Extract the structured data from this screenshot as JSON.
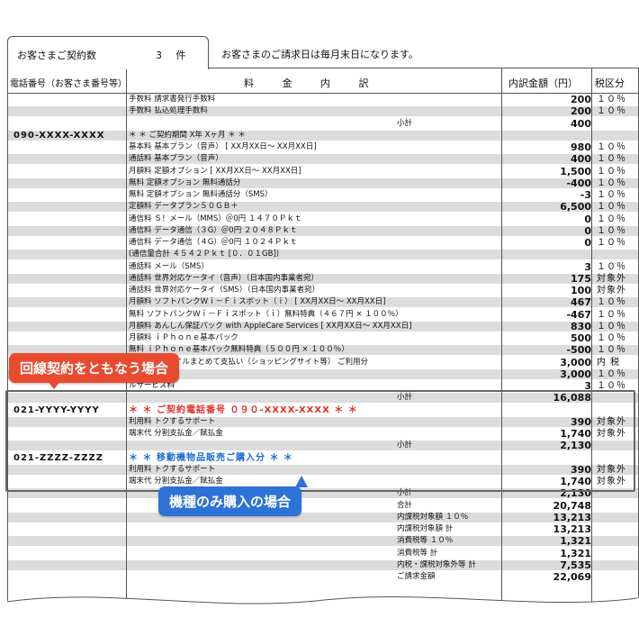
{
  "summary": {
    "contracts_label": "お客さまご契約数",
    "contracts_count": "3 件",
    "billing_notice": "お客さまのご請求日は毎月末日になります。"
  },
  "header": {
    "col_number": "電話番号（お客さま番号等）",
    "col_detail": "料 金 内 訳",
    "col_amount": "内訳金額（円）",
    "col_tax": "税区分"
  },
  "rows": [
    {
      "shade": false,
      "num": "",
      "desc": "手数料  請求書発行手数料",
      "sub": "",
      "amt": "200",
      "tax": "１０％"
    },
    {
      "shade": true,
      "num": "",
      "desc": "手数料  払込処理手数料",
      "sub": "",
      "amt": "200",
      "tax": "１０％"
    },
    {
      "shade": false,
      "num": "",
      "desc": "",
      "sub": "小計",
      "amt": "400",
      "tax": ""
    },
    {
      "shade": true,
      "num": "090-XXXX-XXXX",
      "desc": "＊ ＊ ご契約期間      X年   Xヶ月 ＊ ＊",
      "sub": "",
      "amt": "",
      "tax": ""
    },
    {
      "shade": false,
      "num": "",
      "desc": "基本料  基本プラン（音声）   [  XX月XX日～  XX月XX日]",
      "sub": "",
      "amt": "980",
      "tax": "１０％"
    },
    {
      "shade": true,
      "num": "",
      "desc": "通話料  基本プラン（音声）",
      "sub": "",
      "amt": "400",
      "tax": "１０％"
    },
    {
      "shade": false,
      "num": "",
      "desc": "月額料  定額オプション [  XX月XX日～  XX月XX日]",
      "sub": "",
      "amt": "1,500",
      "tax": "１０％"
    },
    {
      "shade": true,
      "num": "",
      "desc": "  無料   定額オプション  無料通話分",
      "sub": "",
      "amt": "-400",
      "tax": "１０％"
    },
    {
      "shade": false,
      "num": "",
      "desc": "  無料   定額オプション  無料通話分（SMS）",
      "sub": "",
      "amt": "-3",
      "tax": "１０％"
    },
    {
      "shade": true,
      "num": "",
      "desc": "定額料  データプラン５０ＧＢ＋",
      "sub": "",
      "amt": "6,500",
      "tax": "１０％"
    },
    {
      "shade": false,
      "num": "",
      "desc": "通信料  Ｓ！メール（MMS）＠0円  １４７０Ｐｋｔ",
      "sub": "",
      "amt": "0",
      "tax": "１０％"
    },
    {
      "shade": true,
      "num": "",
      "desc": "通信料  データ通信（３G）＠0円  ２０４８Ｐｋｔ",
      "sub": "",
      "amt": "0",
      "tax": "１０％"
    },
    {
      "shade": false,
      "num": "",
      "desc": "通信料  データ通信（４G）＠0円  １０２４Ｐｋｔ",
      "sub": "",
      "amt": "0",
      "tax": "１０％"
    },
    {
      "shade": true,
      "num": "",
      "desc": "   (通信量合計  ４５４２Ｐｋｔ  [０．０１GB])",
      "sub": "",
      "amt": "",
      "tax": ""
    },
    {
      "shade": false,
      "num": "",
      "desc": "通話料  メール（SMS）",
      "sub": "",
      "amt": "3",
      "tax": "１０％"
    },
    {
      "shade": true,
      "num": "",
      "desc": "通話料  世界対応ケータイ（音声）（日本国内事業者宛）",
      "sub": "",
      "amt": "175",
      "tax": "対象外"
    },
    {
      "shade": false,
      "num": "",
      "desc": "通話料  世界対応ケータイ（SMS）（日本国内事業者宛）",
      "sub": "",
      "amt": "100",
      "tax": "対象外"
    },
    {
      "shade": true,
      "num": "",
      "desc": "月額料  ソフトバンクＷｉ－Ｆｉスポット（ｉ）   [  XX月XX日～  XX月XX日]",
      "sub": "",
      "amt": "467",
      "tax": "１０％"
    },
    {
      "shade": false,
      "num": "",
      "desc": "  無料   ソフトバンクＷｉ－Ｆｉスポット（ｉ）無料特典（４６７円 × １００％）",
      "sub": "",
      "amt": "-467",
      "tax": "１０％"
    },
    {
      "shade": true,
      "num": "",
      "desc": "月額料  あんしん保証パック  with AppleCare Services  [  XX月XX日～  XX月XX日]",
      "sub": "",
      "amt": "830",
      "tax": "１０％"
    },
    {
      "shade": false,
      "num": "",
      "desc": "月額料  ｉＰｈｏｎｅ基本パック",
      "sub": "",
      "amt": "500",
      "tax": "１０％"
    },
    {
      "shade": true,
      "num": "",
      "desc": "  無料   ｉＰｈｏｎｅ基本パック無料特典（５００円 × １００％）",
      "sub": "",
      "amt": "-500",
      "tax": "１０％"
    },
    {
      "shade": false,
      "num": "",
      "desc": "                     ク・ワイモバイルまとめて支払い（ショッピングサイト等）  ご利用分",
      "sub": "",
      "amt": "3,000",
      "tax": "内 税"
    },
    {
      "shade": true,
      "num": "",
      "desc": "                     数料",
      "sub": "",
      "amt": "3,000",
      "tax": "１０％"
    },
    {
      "shade": false,
      "num": "",
      "desc": "                     ルサービス料",
      "sub": "",
      "amt": "3",
      "tax": "１０％"
    },
    {
      "shade": true,
      "num": "",
      "desc": "",
      "sub": "小計",
      "amt": "16,088",
      "tax": ""
    },
    {
      "shade": false,
      "num": "021-YYYY-YYYY",
      "desc": "＊ ＊ ご契約電話番号  ０９０-XXXX-XXXX  ＊ ＊",
      "color": "red",
      "sub": "",
      "amt": "",
      "tax": ""
    },
    {
      "shade": true,
      "num": "",
      "desc": "利用料  トクするサポート",
      "sub": "",
      "amt": "390",
      "tax": "対象外"
    },
    {
      "shade": false,
      "num": "",
      "desc": "端末代  分割支払金／賦払金",
      "sub": "",
      "amt": "1,740",
      "tax": "対象外"
    },
    {
      "shade": true,
      "num": "",
      "desc": "",
      "sub": "小計",
      "amt": "2,130",
      "tax": ""
    },
    {
      "shade": false,
      "num": "021-ZZZZ-ZZZZ",
      "desc": "＊ ＊ 移動機物品販売ご購入分 ＊ ＊",
      "color": "blue",
      "sub": "",
      "amt": "",
      "tax": ""
    },
    {
      "shade": true,
      "num": "",
      "desc": "利用料  トクするサポート",
      "sub": "",
      "amt": "390",
      "tax": "対象外"
    },
    {
      "shade": false,
      "num": "",
      "desc": "端末代  分割支払金／賦払金",
      "sub": "",
      "amt": "1,740",
      "tax": "対象外"
    },
    {
      "shade": true,
      "num": "",
      "desc": "",
      "sub": "小計",
      "amt": "2,130",
      "tax": ""
    },
    {
      "shade": false,
      "num": "",
      "desc": "",
      "sub": "合計",
      "amt": "20,748",
      "tax": ""
    },
    {
      "shade": true,
      "num": "",
      "desc": "",
      "sub": "内課税対象額  １０％",
      "amt": "13,213",
      "tax": ""
    },
    {
      "shade": false,
      "num": "",
      "desc": "",
      "sub": "内課税対象額  計",
      "amt": "13,213",
      "tax": ""
    },
    {
      "shade": true,
      "num": "",
      "desc": "",
      "sub": "消費税等  １０％",
      "amt": "1,321",
      "tax": ""
    },
    {
      "shade": false,
      "num": "",
      "desc": "",
      "sub": "消費税等  計",
      "amt": "1,321",
      "tax": ""
    },
    {
      "shade": true,
      "num": "",
      "desc": "",
      "sub": "内税・課税対象外等  計",
      "amt": "7,535",
      "tax": ""
    },
    {
      "shade": false,
      "num": "",
      "desc": "",
      "sub": "ご請求金額",
      "amt": "22,069",
      "tax": ""
    }
  ],
  "callouts": {
    "line_contract": "回線契約をともなう場合",
    "device_only": "機種のみ購入の場合"
  },
  "colors": {
    "red": "#e94b2f",
    "blue": "#2d72d6",
    "shade": "#dcdcdc"
  }
}
